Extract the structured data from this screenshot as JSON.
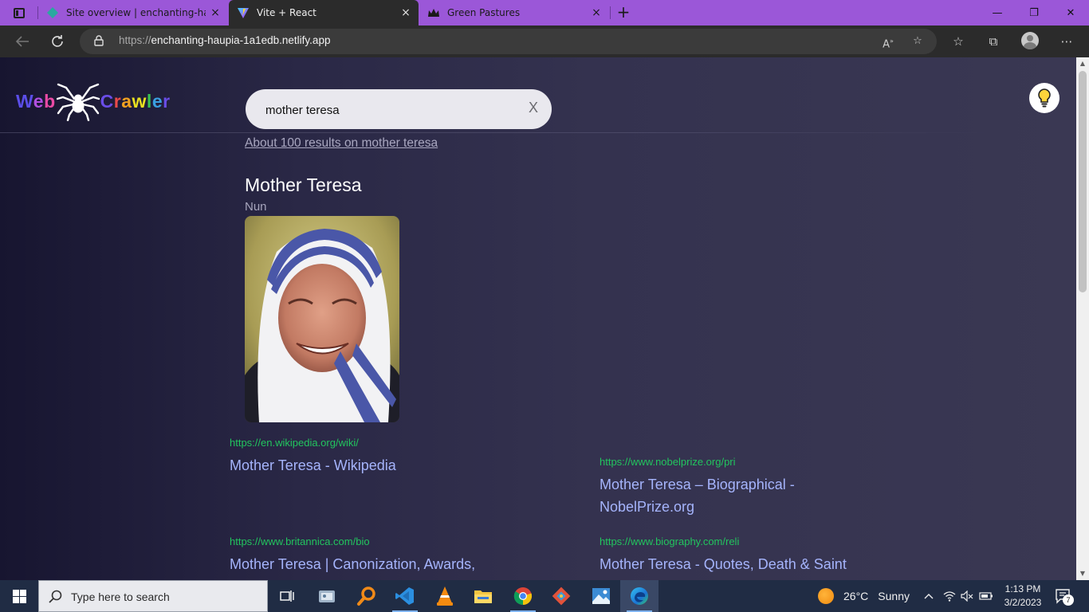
{
  "browser": {
    "tabs": [
      {
        "title": "Site overview | enchanting-haupia",
        "close": "×",
        "active": false
      },
      {
        "title": "Vite + React",
        "close": "×",
        "active": true
      },
      {
        "title": "Green Pastures",
        "close": "×",
        "active": false
      }
    ],
    "new_tab": "+",
    "window_controls": {
      "minimize": "—",
      "restore": "❐",
      "close": "✕"
    },
    "url_scheme": "https://",
    "url_host": "enchanting-haupia-1a1edb.netlify.app"
  },
  "page": {
    "logo": {
      "left": "Web",
      "right": "Crawler",
      "left_colors": [
        "#5b4ee8",
        "#b04fe0",
        "#e94aa5"
      ],
      "right_colors": [
        "#6a4de8",
        "#e94a4a",
        "#f0a020",
        "#e8e020",
        "#3ac450",
        "#3aa0e0"
      ]
    },
    "search": {
      "value": "mother teresa",
      "clear_label": "X"
    },
    "result_count": "About 100 results on mother teresa",
    "knowledge_panel": {
      "title": "Mother Teresa",
      "subtitle": "Nun"
    },
    "results": [
      {
        "url": "https://en.wikipedia.org/wiki/",
        "title": "Mother Teresa - Wikipedia"
      },
      {
        "url": "https://www.nobelprize.org/pri",
        "title": "Mother Teresa – Biographical - NobelPrize.org"
      },
      {
        "url": "https://www.britannica.com/bio",
        "title": "Mother Teresa | Canonization, Awards, Facts, & Feast Day | Britannica"
      },
      {
        "url": "https://www.biography.com/reli",
        "title": "Mother Teresa - Quotes, Death & Saint - Biography (Bio)"
      }
    ],
    "colors": {
      "url_green": "#22c55e",
      "title_blue": "#a5b4fc"
    }
  },
  "taskbar": {
    "search_placeholder": "Type here to search",
    "weather": {
      "temp": "26°C",
      "condition": "Sunny"
    },
    "time": "1:13 PM",
    "date": "3/2/2023",
    "notifications": "7"
  }
}
